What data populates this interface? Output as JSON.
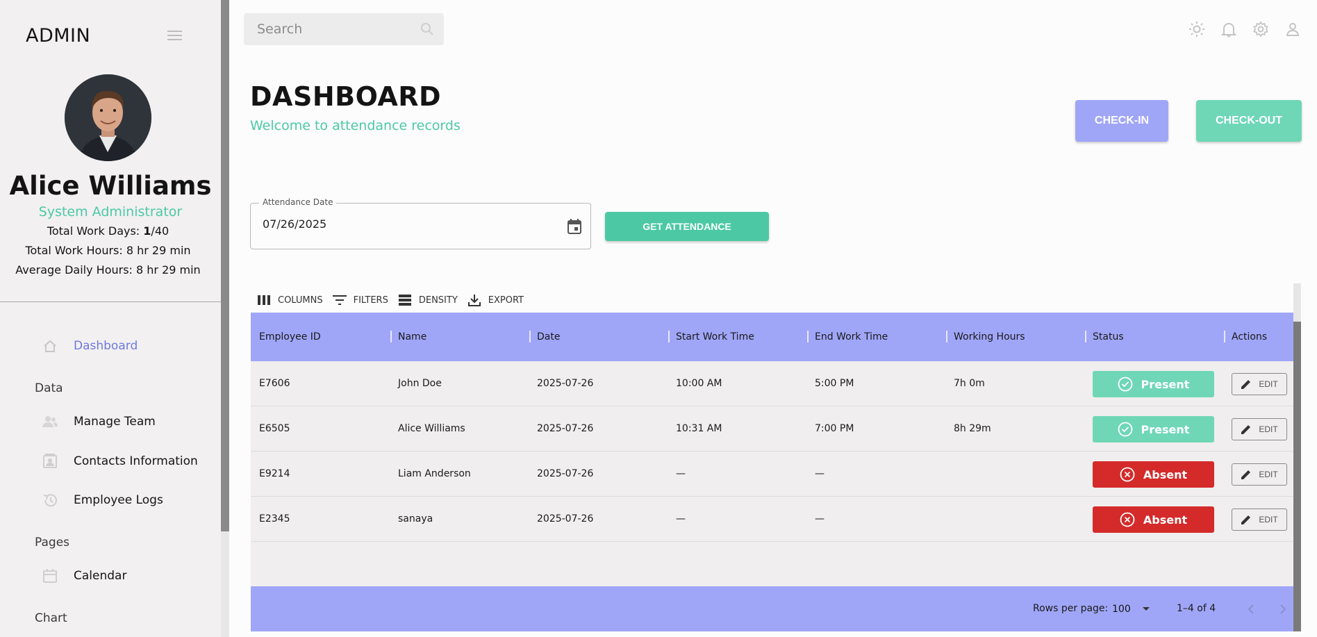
{
  "sidebar": {
    "brand": "ADMIN",
    "profile": {
      "name": "Alice Williams",
      "role": "System Administrator",
      "work_days_label": "Total Work Days: ",
      "work_days_value": "1",
      "work_days_total": "/40",
      "work_hours": "Total Work Hours: 8 hr 29 min",
      "avg_hours": "Average Daily Hours: 8 hr 29 min"
    },
    "nav": {
      "dashboard": "Dashboard",
      "section_data": "Data",
      "manage_team": "Manage Team",
      "contacts": "Contacts Information",
      "employee_logs": "Employee Logs",
      "section_pages": "Pages",
      "calendar": "Calendar",
      "section_chart": "Chart"
    }
  },
  "topbar": {
    "search_placeholder": "Search"
  },
  "header": {
    "title": "DASHBOARD",
    "subtitle": "Welcome to attendance records",
    "checkin_label": "CHECK-IN",
    "checkout_label": "CHECK-OUT"
  },
  "filter": {
    "date_label": "Attendance Date",
    "date_value": "07/26/2025",
    "get_label": "GET ATTENDANCE"
  },
  "toolbar": {
    "columns": "COLUMNS",
    "filters": "FILTERS",
    "density": "DENSITY",
    "export": "EXPORT"
  },
  "table": {
    "columns": [
      "Employee ID",
      "Name",
      "Date",
      "Start Work Time",
      "End Work Time",
      "Working Hours",
      "Status",
      "Actions"
    ],
    "rows": [
      {
        "id": "E7606",
        "name": "John Doe",
        "date": "2025-07-26",
        "start": "10:00 AM",
        "end": "5:00 PM",
        "hours": "7h 0m",
        "status": "Present",
        "action": "EDIT"
      },
      {
        "id": "E6505",
        "name": "Alice Williams",
        "date": "2025-07-26",
        "start": "10:31 AM",
        "end": "7:00 PM",
        "hours": "8h 29m",
        "status": "Present",
        "action": "EDIT"
      },
      {
        "id": "E9214",
        "name": "Liam Anderson",
        "date": "2025-07-26",
        "start": "—",
        "end": "—",
        "hours": "",
        "status": "Absent",
        "action": "EDIT"
      },
      {
        "id": "E2345",
        "name": "sanaya",
        "date": "2025-07-26",
        "start": "—",
        "end": "—",
        "hours": "",
        "status": "Absent",
        "action": "EDIT"
      }
    ],
    "footer": {
      "rows_per_page_label": "Rows per page:",
      "rows_per_page_value": "100",
      "range": "1–4 of 4"
    }
  },
  "colors": {
    "accent_purple": "#a0a6f7",
    "accent_green": "#4cc9a4",
    "present": "#6fd7b6",
    "absent": "#d42a2a"
  }
}
